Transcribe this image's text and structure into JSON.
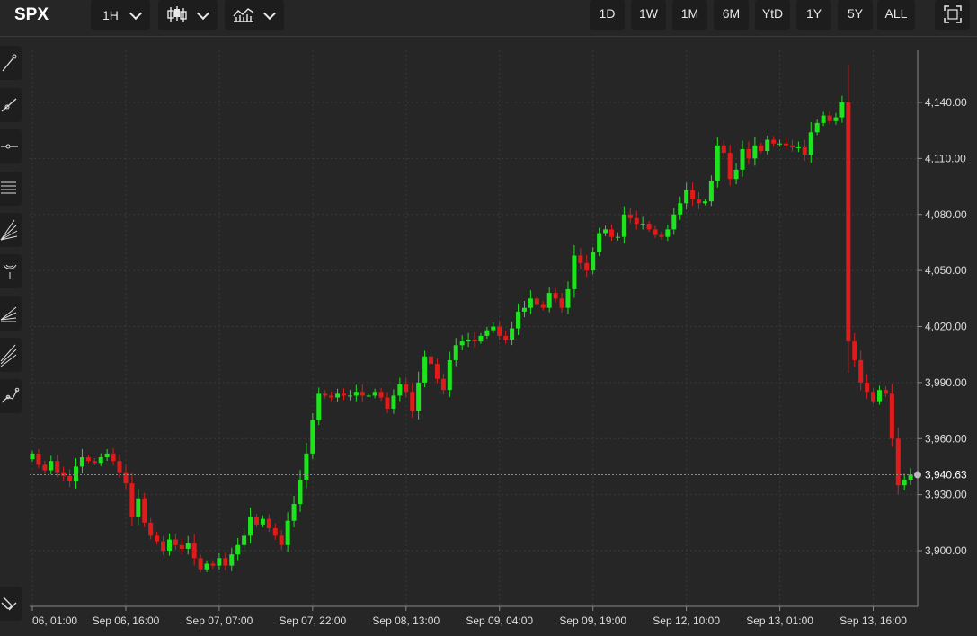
{
  "toolbar": {
    "symbol": "SPX",
    "interval_label": "1H",
    "chart_style_icon": "candlestick-icon",
    "indicator_icon": "indicators-icon",
    "ranges": [
      "1D",
      "1W",
      "1M",
      "6M",
      "YtD",
      "1Y",
      "5Y",
      "ALL"
    ],
    "fullscreen_icon": "fullscreen-icon"
  },
  "drawing_tools": [
    "trend-line-icon",
    "ray-icon",
    "horizontal-line-icon",
    "fib-retracement-icon",
    "fib-fan-icon",
    "fib-arc-icon",
    "gann-fan-icon",
    "speed-lines-icon",
    "polyline-icon",
    "magnet-icon"
  ],
  "colors": {
    "up": "#1de41d",
    "down": "#e01b1b",
    "background": "#262626",
    "grid": "#3a3a3a"
  },
  "chart_data": {
    "type": "candlestick",
    "last_price": 3940.63,
    "last_price_label": "3,940.63",
    "ylim": [
      3870,
      4175
    ],
    "y_ticks": [
      {
        "v": 4140,
        "label": "4,140.00"
      },
      {
        "v": 4110,
        "label": "4,110.00"
      },
      {
        "v": 4080,
        "label": "4,080.00"
      },
      {
        "v": 4050,
        "label": "4,050.00"
      },
      {
        "v": 4020,
        "label": "4,020.00"
      },
      {
        "v": 3990,
        "label": "3,990.00"
      },
      {
        "v": 3960,
        "label": "3,960.00"
      },
      {
        "v": 3930,
        "label": "3,930.00"
      },
      {
        "v": 3900,
        "label": "3,900.00"
      }
    ],
    "x_ticks": [
      {
        "i": 0,
        "label": "06, 01:00"
      },
      {
        "i": 15,
        "label": "Sep 06, 16:00"
      },
      {
        "i": 30,
        "label": "Sep 07, 07:00"
      },
      {
        "i": 45,
        "label": "Sep 07, 22:00"
      },
      {
        "i": 60,
        "label": "Sep 08, 13:00"
      },
      {
        "i": 75,
        "label": "Sep 09, 04:00"
      },
      {
        "i": 90,
        "label": "Sep 09, 19:00"
      },
      {
        "i": 105,
        "label": "Sep 12, 10:00"
      },
      {
        "i": 120,
        "label": "Sep 13, 01:00"
      },
      {
        "i": 135,
        "label": "Sep 13, 16:00"
      }
    ],
    "closes": [
      3952,
      3946,
      3943,
      3948,
      3942,
      3940,
      3937,
      3945,
      3950,
      3948,
      3947,
      3950,
      3952,
      3948,
      3942,
      3936,
      3918,
      3928,
      3915,
      3908,
      3905,
      3900,
      3906,
      3903,
      3901,
      3904,
      3896,
      3890,
      3893,
      3892,
      3896,
      3892,
      3898,
      3903,
      3908,
      3918,
      3914,
      3917,
      3912,
      3908,
      3903,
      3916,
      3925,
      3938,
      3952,
      3970,
      3984,
      3983,
      3982,
      3984,
      3983,
      3983,
      3985,
      3983,
      3983,
      3985,
      3982,
      3976,
      3983,
      3989,
      3985,
      3975,
      3990,
      4004,
      4000,
      3992,
      3986,
      4002,
      4010,
      4012,
      4013,
      4012,
      4015,
      4018,
      4020,
      4015,
      4013,
      4019,
      4028,
      4030,
      4035,
      4032,
      4030,
      4038,
      4035,
      4030,
      4040,
      4058,
      4054,
      4050,
      4060,
      4070,
      4072,
      4068,
      4068,
      4080,
      4078,
      4075,
      4075,
      4072,
      4069,
      4068,
      4072,
      4080,
      4086,
      4093,
      4088,
      4086,
      4087,
      4098,
      4117,
      4113,
      4099,
      4104,
      4115,
      4110,
      4117,
      4114,
      4120,
      4118,
      4118,
      4117,
      4116,
      4116,
      4112,
      4124,
      4129,
      4133,
      4130,
      4132,
      4140,
      4012,
      4002,
      3990,
      3985,
      3980,
      3986,
      3984,
      3960,
      3935,
      3938,
      3940.63
    ]
  }
}
